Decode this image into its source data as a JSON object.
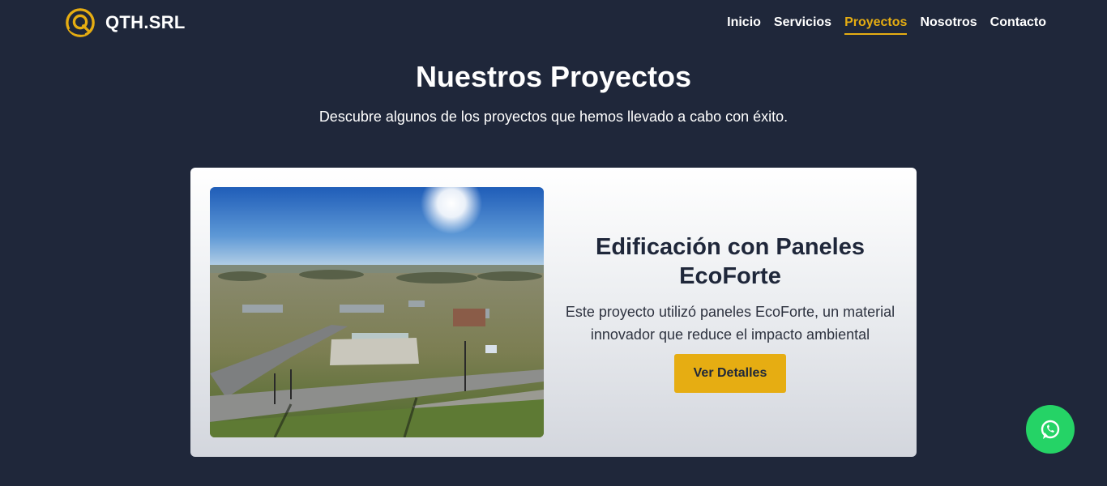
{
  "brand": {
    "name": "QTH.SRL",
    "logo_icon": "q-ring-logo-icon",
    "accent": "#e6ad12"
  },
  "nav": {
    "items": [
      {
        "label": "Inicio",
        "active": false
      },
      {
        "label": "Servicios",
        "active": false
      },
      {
        "label": "Proyectos",
        "active": true
      },
      {
        "label": "Nosotros",
        "active": false
      },
      {
        "label": "Contacto",
        "active": false
      }
    ]
  },
  "hero": {
    "title": "Nuestros Proyectos",
    "subtitle": "Descubre algunos de los proyectos que hemos llevado a cabo con éxito."
  },
  "projects": [
    {
      "title": "Edificación con Paneles EcoForte",
      "description": "Este proyecto utilizó paneles EcoForte, un material innovador que reduce el impacto ambiental",
      "button_label": "Ver Detalles",
      "image": "aerial-construction-site-photo"
    }
  ],
  "floating": {
    "whatsapp_icon": "whatsapp-icon",
    "color": "#25d366"
  },
  "colors": {
    "background": "#1f273a",
    "accent": "#e6ad12",
    "text_dark": "#1f273a"
  }
}
